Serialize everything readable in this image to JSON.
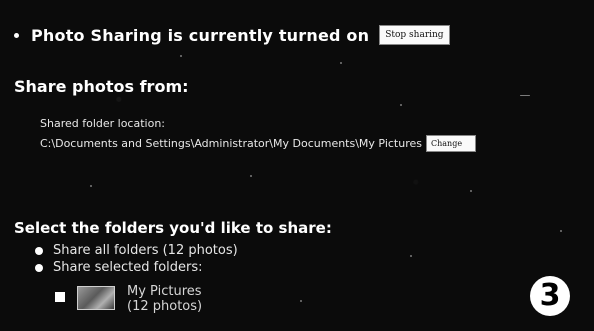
{
  "status": {
    "text": "Photo Sharing is currently turned on",
    "stop_button": "Stop sharing"
  },
  "share_from": {
    "heading": "Share photos from:",
    "folder_label": "Shared folder location:",
    "folder_path": "C:\\Documents and Settings\\Administrator\\My Documents\\My Pictures",
    "change_button": "Change"
  },
  "select": {
    "heading": "Select the folders you'd like to share:",
    "option_all": "Share all folders (12 photos)",
    "option_selected": "Share selected folders:",
    "folder_name": "My Pictures",
    "folder_count": "(12 photos)"
  },
  "badge": {
    "number": "3"
  }
}
